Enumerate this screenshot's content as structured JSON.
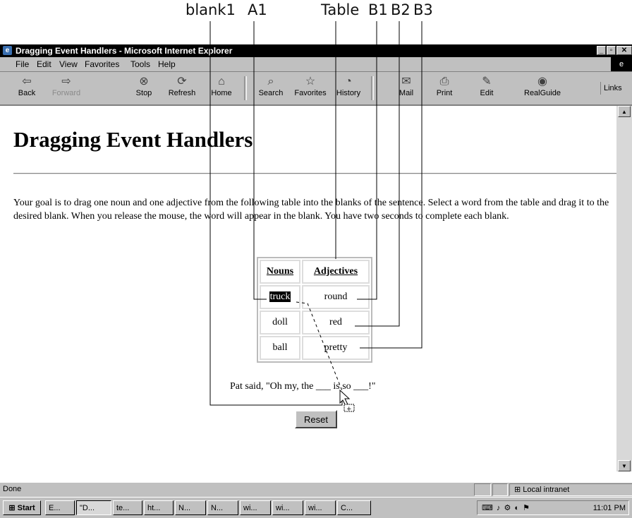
{
  "callouts": [
    "blank1",
    "A1",
    "Table",
    "B1",
    "B2",
    "B3"
  ],
  "window": {
    "title": "Dragging Event Handlers - Microsoft Internet Explorer"
  },
  "menu": [
    "File",
    "Edit",
    "View",
    "Favorites",
    "Tools",
    "Help"
  ],
  "toolbar": [
    {
      "label": "Back",
      "icon": "back-arrow-icon",
      "glyph": "⇦"
    },
    {
      "label": "Forward",
      "icon": "forward-arrow-icon",
      "glyph": "⇨"
    },
    {
      "label": "Stop",
      "icon": "stop-icon",
      "glyph": "⊗"
    },
    {
      "label": "Refresh",
      "icon": "refresh-icon",
      "glyph": "⟳"
    },
    {
      "label": "Home",
      "icon": "home-icon",
      "glyph": "⌂"
    },
    {
      "label": "Search",
      "icon": "search-icon",
      "glyph": "⌕"
    },
    {
      "label": "Favorites",
      "icon": "favorites-icon",
      "glyph": "☆"
    },
    {
      "label": "History",
      "icon": "history-icon",
      "glyph": "◔"
    },
    {
      "label": "Mail",
      "icon": "mail-icon",
      "glyph": "✉"
    },
    {
      "label": "Print",
      "icon": "print-icon",
      "glyph": "⎙"
    },
    {
      "label": "Edit",
      "icon": "edit-icon",
      "glyph": "✎"
    },
    {
      "label": "RealGuide",
      "icon": "realguide-icon",
      "glyph": "◉"
    }
  ],
  "links_label": "Links",
  "page": {
    "heading": "Dragging Event Handlers",
    "instructions": "Your goal is to drag one noun and one adjective from the following table into the blanks of the sentence. Select a word from the table and drag it to the desired blank. When you release the mouse, the word will appear in the blank. You have two seconds to complete each blank.",
    "table": {
      "headers": [
        "Nouns",
        "Adjectives"
      ],
      "rows": [
        [
          "truck",
          "round"
        ],
        [
          "doll",
          "red"
        ],
        [
          "ball",
          "pretty"
        ]
      ]
    },
    "sentence": "Pat said, \"Oh my, the ___ is so ___!\"",
    "reset_label": "Reset"
  },
  "status": {
    "text": "Done",
    "zone": "Local intranet"
  },
  "taskbar": {
    "start": "Start",
    "tasks": [
      "E...",
      "\"D...",
      "te...",
      "ht...",
      "N...",
      "N...",
      "wi...",
      "wi...",
      "wi...",
      "C..."
    ],
    "clock": "11:01 PM"
  },
  "colors": {
    "titlebar": "#000000",
    "chrome": "#c0c0c0",
    "selection": "#000000"
  }
}
